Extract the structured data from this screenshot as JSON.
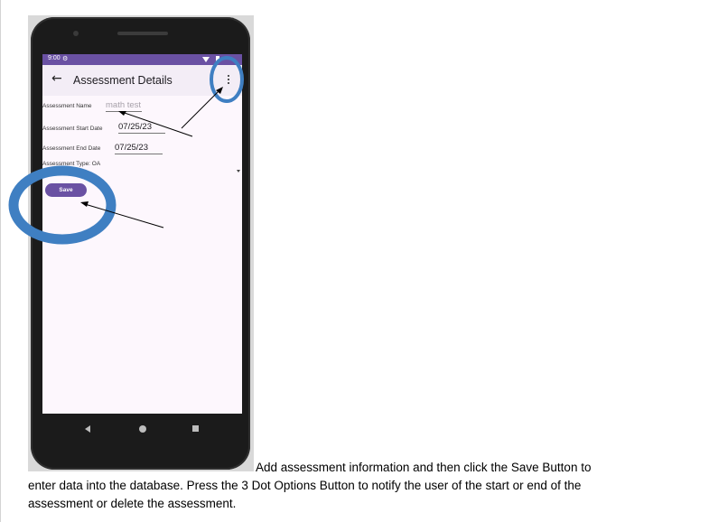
{
  "app": {
    "status_time": "9:00",
    "title": "Assessment Details"
  },
  "form": {
    "name_label": "Assessment Name",
    "name_value": "math test",
    "start_label": "Assessment Start Date",
    "start_value": "07/25/23",
    "end_label": "Assessment End Date",
    "end_value": "07/25/23",
    "type_label": "Assessment Type: OA",
    "save_label": "Save"
  },
  "caption": {
    "line1": "Add assessment information and then click the Save Button to",
    "line2": "enter data into the database. Press the 3 Dot Options Button to notify the user of the start or end of the",
    "line3": "assessment or delete the assessment."
  },
  "colors": {
    "accent": "#6a51a3",
    "highlight_ring": "#3f7fc2",
    "app_bar": "#f3edf6"
  },
  "icons": [
    "back-arrow-icon",
    "more-vert-icon",
    "wifi-icon",
    "battery-icon",
    "nav-back-icon",
    "nav-home-icon",
    "nav-recents-icon"
  ]
}
